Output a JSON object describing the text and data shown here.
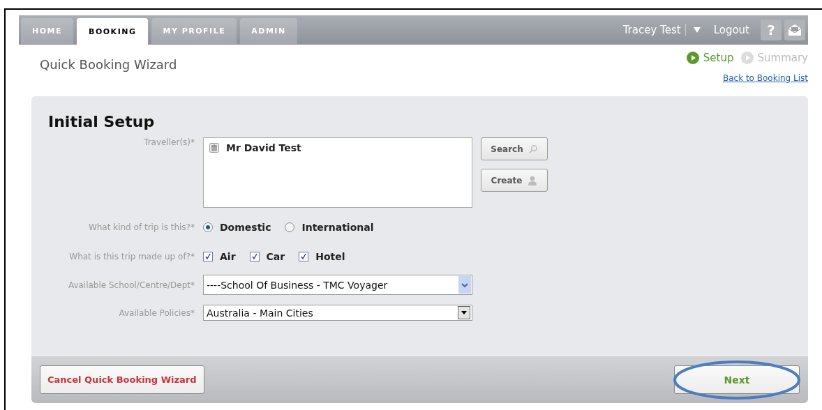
{
  "tabs": [
    {
      "label": "HOME",
      "selected": false
    },
    {
      "label": "BOOKING",
      "selected": true
    },
    {
      "label": "MY PROFILE",
      "selected": false
    },
    {
      "label": "ADMIN",
      "selected": false
    }
  ],
  "user_menu": {
    "name": "Tracey Test",
    "logout": "Logout",
    "help": "?"
  },
  "page_title": "Quick Booking Wizard",
  "steps": [
    {
      "label": "Setup",
      "selected": true
    },
    {
      "label": "Summary",
      "selected": false
    }
  ],
  "back_link": "Back to Booking List",
  "form": {
    "title": "Initial Setup",
    "travellers": {
      "label": "Traveller(s)*",
      "items": [
        "Mr David Test"
      ],
      "search_button": "Search",
      "create_button": "Create"
    },
    "trip_kind": {
      "label": "What kind of trip is this?*",
      "options": [
        {
          "label": "Domestic",
          "selected": true
        },
        {
          "label": "International",
          "selected": false
        }
      ]
    },
    "trip_parts": {
      "label": "What is this trip made up of?*",
      "options": [
        {
          "label": "Air",
          "checked": true
        },
        {
          "label": "Car",
          "checked": true
        },
        {
          "label": "Hotel",
          "checked": true
        }
      ]
    },
    "department": {
      "label": "Available School/Centre/Dept*",
      "value": "----School Of Business - TMC Voyager"
    },
    "policies": {
      "label": "Available Policies*",
      "value": "Australia - Main Cities"
    }
  },
  "footer": {
    "cancel_button": "Cancel Quick Booking Wizard",
    "next_button": "Next",
    "next_highlighted": true
  }
}
